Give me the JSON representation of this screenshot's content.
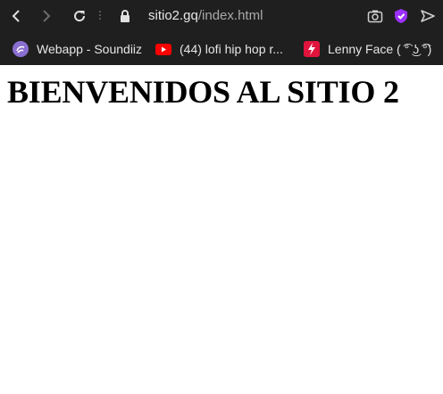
{
  "browser": {
    "url_domain": "sitio2.gq",
    "url_path": "/index.html"
  },
  "bookmarks": [
    {
      "label": "Webapp - Soundiiz",
      "icon": "soundiiz-icon"
    },
    {
      "label": "(44) lofi hip hop r...",
      "icon": "youtube-icon"
    },
    {
      "label": "Lenny Face ( ͡° ͜ʖ ͡°)",
      "icon": "lenny-face-icon"
    }
  ],
  "page": {
    "heading": "BIENVENIDOS AL SITIO 2"
  },
  "colors": {
    "chrome_bg": "#1f1f1f",
    "shield_purple": "#9b30ff",
    "youtube_red": "#ff0000"
  }
}
